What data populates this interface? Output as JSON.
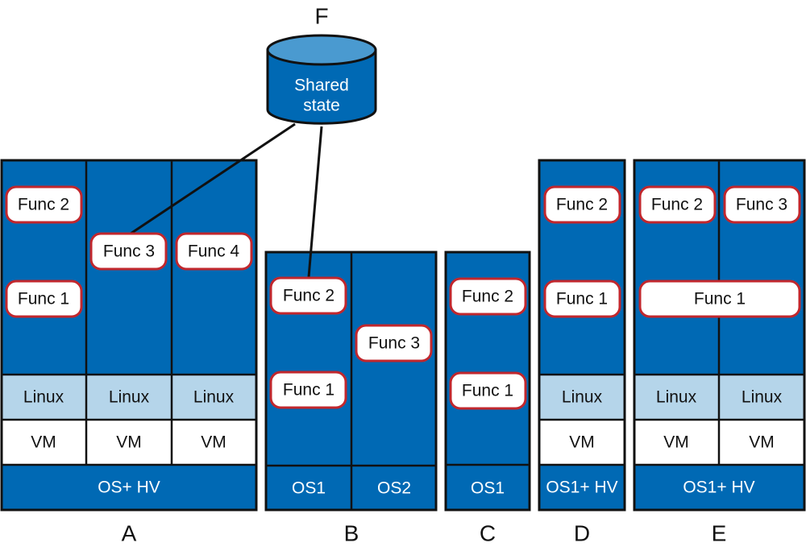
{
  "colors": {
    "host_blue": "#0069b4",
    "linux_band": "#b5d5ea",
    "func_border": "#c1272d",
    "db_top": "#4a9ad0"
  },
  "shared_state": {
    "label": "F",
    "line1": "Shared",
    "line2": "state"
  },
  "A": {
    "label": "A",
    "funcs": [
      "Func 2",
      "Func 1",
      "Func 3",
      "Func 4"
    ],
    "linux": [
      "Linux",
      "Linux",
      "Linux"
    ],
    "vm": [
      "VM",
      "VM",
      "VM"
    ],
    "base": "OS+ HV"
  },
  "B": {
    "label": "B",
    "funcs": [
      "Func 2",
      "Func 1",
      "Func 3"
    ],
    "os": [
      "OS1",
      "OS2"
    ]
  },
  "C": {
    "label": "C",
    "funcs": [
      "Func 2",
      "Func 1"
    ],
    "os": "OS1"
  },
  "D": {
    "label": "D",
    "funcs": [
      "Func 2",
      "Func 1"
    ],
    "linux": "Linux",
    "vm": "VM",
    "base": "OS1+ HV"
  },
  "E": {
    "label": "E",
    "funcs": [
      "Func 2",
      "Func 3",
      "Func 1"
    ],
    "linux": [
      "Linux",
      "Linux"
    ],
    "vm": [
      "VM",
      "VM"
    ],
    "base": "OS1+ HV"
  }
}
